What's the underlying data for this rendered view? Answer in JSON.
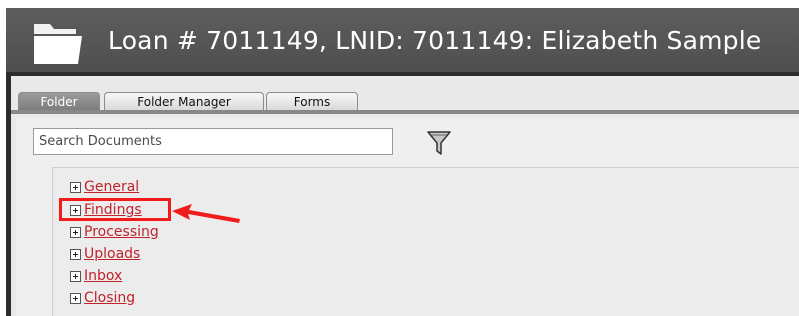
{
  "window": {
    "title": "Loan # 7011149, LNID: 7011149: Elizabeth Sample",
    "icon": "folder-icon"
  },
  "tabs": [
    {
      "label": "Folder",
      "active": true
    },
    {
      "label": "Folder Manager",
      "active": false
    },
    {
      "label": "Forms",
      "active": false
    }
  ],
  "search": {
    "placeholder": "Search Documents",
    "value": "",
    "filter_icon": "funnel-filter-icon"
  },
  "tree": {
    "items": [
      {
        "label": "General",
        "expanded": false
      },
      {
        "label": "Findings",
        "expanded": false,
        "highlighted": true
      },
      {
        "label": "Processing",
        "expanded": false
      },
      {
        "label": "Uploads",
        "expanded": false
      },
      {
        "label": "Inbox",
        "expanded": false
      },
      {
        "label": "Closing",
        "expanded": false
      }
    ]
  },
  "annotation": {
    "color": "#f21b1b",
    "target": "Findings",
    "arrow_icon": "arrow-left-icon"
  },
  "colors": {
    "title_bar": "#555555",
    "link": "#c0232b",
    "active_tab": "#8a8a8a"
  }
}
